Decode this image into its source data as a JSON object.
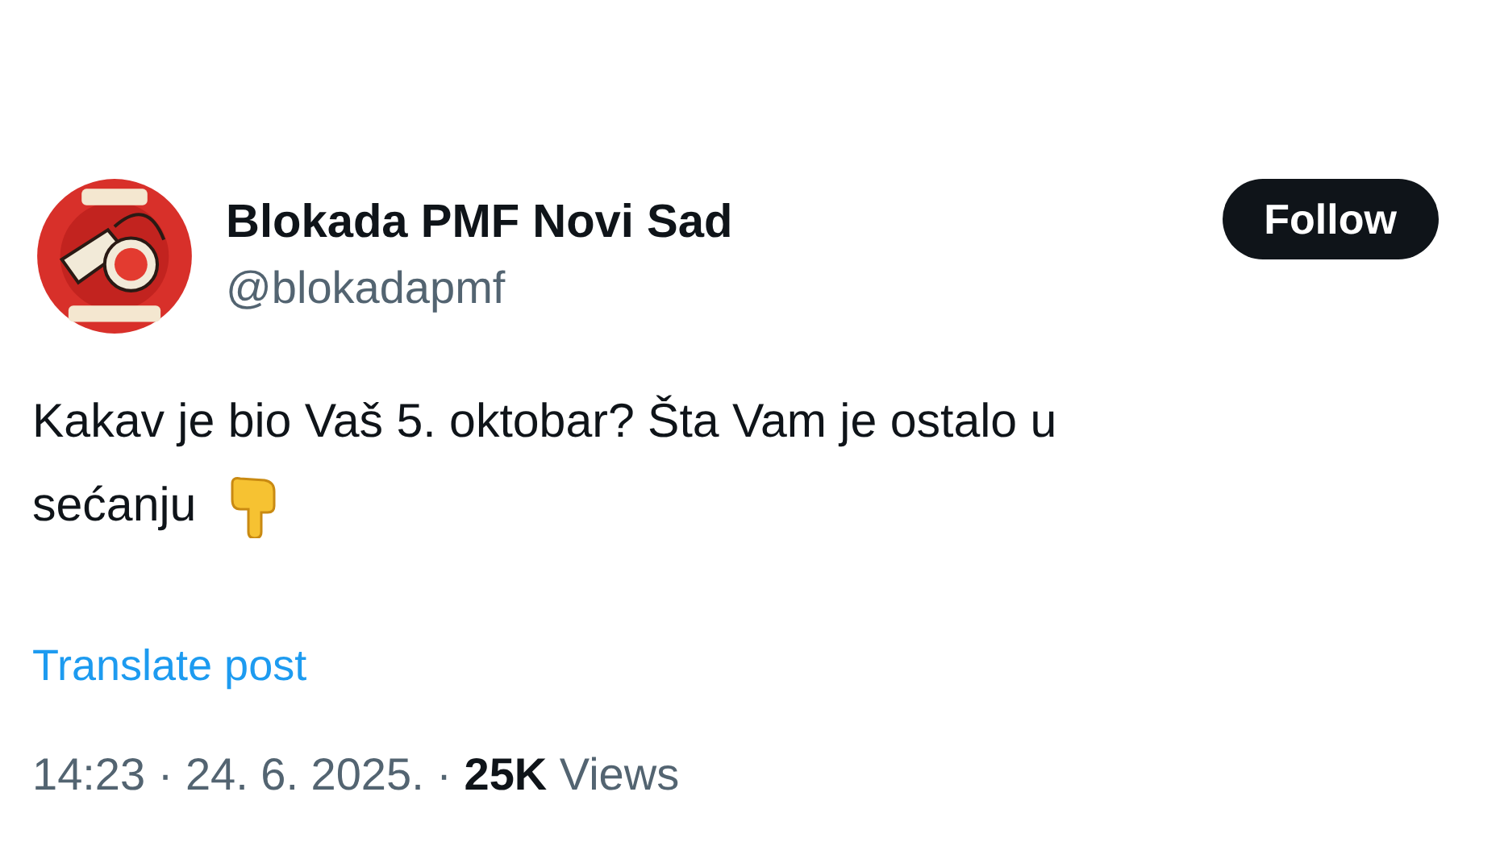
{
  "author": {
    "name": "Blokada PMF Novi Sad",
    "handle": "@blokadapmf"
  },
  "follow_button": "Follow",
  "post": {
    "text_lines": [
      "Kakav je bio Vaš 5. oktobar? Šta Vam je ostalo u",
      "sećanju"
    ]
  },
  "translate_link": "Translate post",
  "meta": "14:23 · 24. 6. 2025. · **25K** Views"
}
